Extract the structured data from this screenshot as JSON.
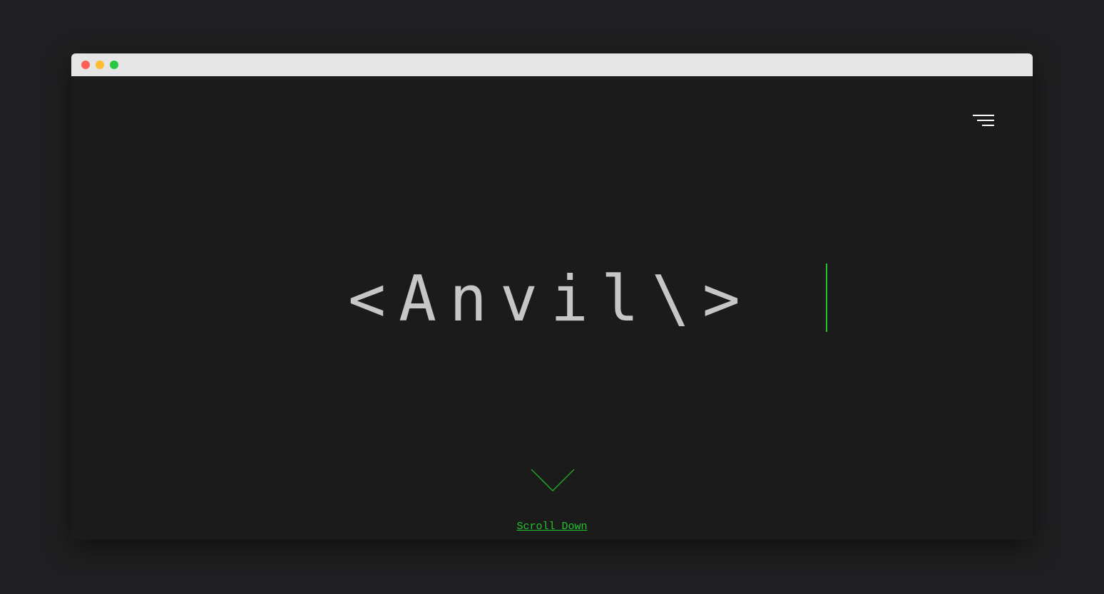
{
  "window": {
    "controls": [
      "close",
      "minimize",
      "maximize"
    ]
  },
  "header": {
    "menu_icon": "hamburger-menu-icon"
  },
  "hero": {
    "title": "<Anvil\\>",
    "cursor_color": "#22c32c"
  },
  "scroll": {
    "arrow_icon": "chevron-down-icon",
    "label": "Scroll Down"
  },
  "colors": {
    "background": "#1b1b1b",
    "accent": "#22c32c",
    "title_text": "#c6c6c6"
  }
}
